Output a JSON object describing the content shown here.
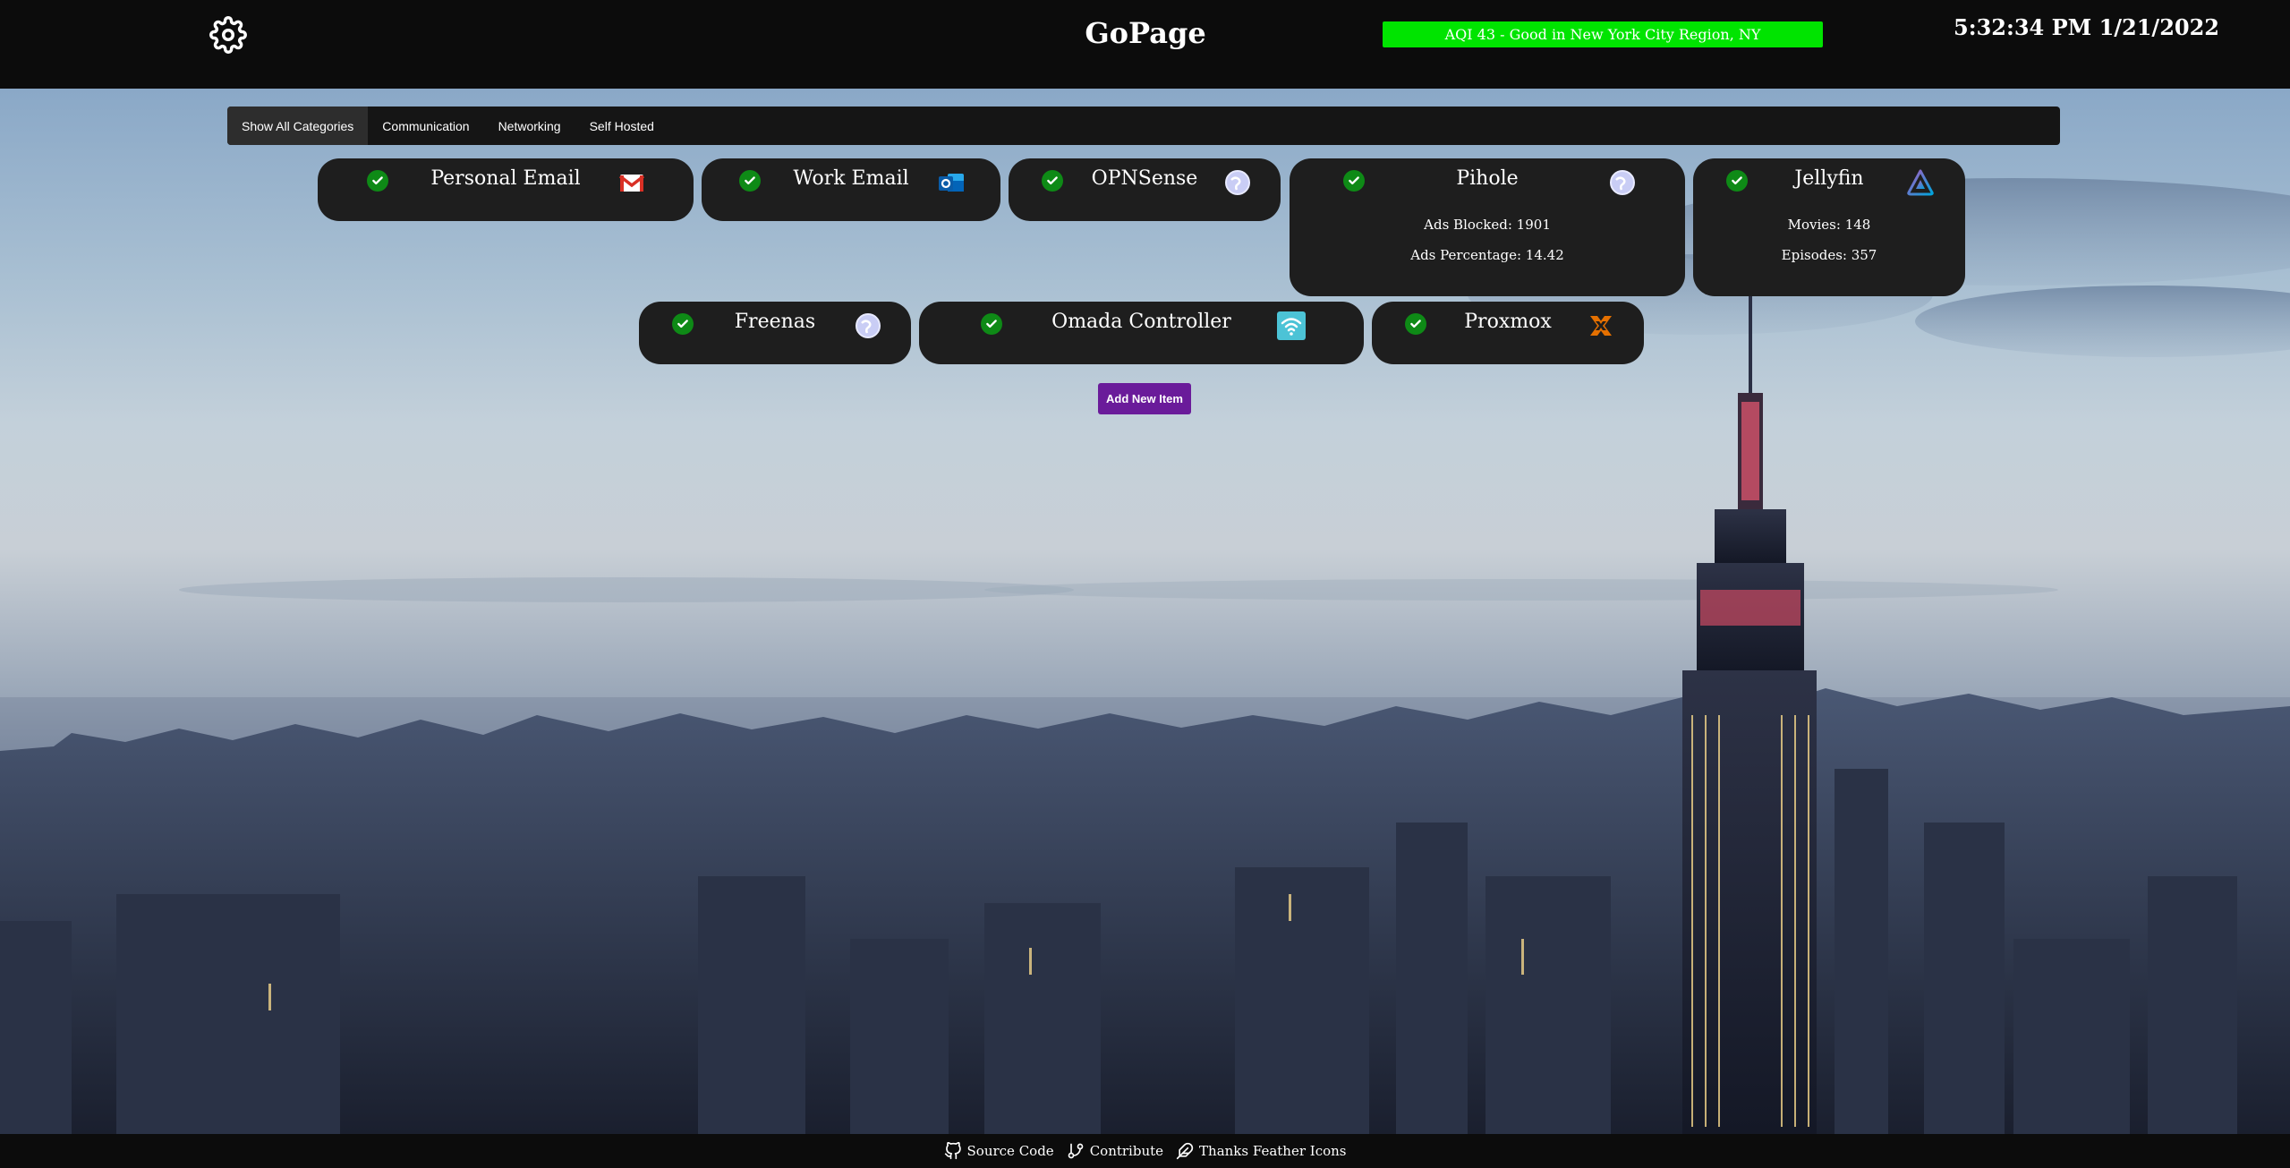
{
  "header": {
    "title": "GoPage",
    "aqi_text": "AQI 43 - Good in New York City Region, NY",
    "aqi_color": "#00e400",
    "clock": "5:32:34 PM 1/21/2022",
    "settings_icon": "gear-icon"
  },
  "tabs": [
    {
      "label": "Show All Categories",
      "active": true
    },
    {
      "label": "Communication"
    },
    {
      "label": "Networking"
    },
    {
      "label": "Self Hosted"
    }
  ],
  "cards": [
    {
      "title": "Personal Email",
      "icon": "gmail-icon",
      "status": "check-icon"
    },
    {
      "title": "Work Email",
      "icon": "outlook-icon",
      "status": "check-icon"
    },
    {
      "title": "OPNSense",
      "icon": "globe-icon",
      "status": "check-icon"
    },
    {
      "title": "Pihole",
      "icon": "globe-icon",
      "status": "check-icon",
      "stats": [
        "Ads Blocked: 1901",
        "Ads Percentage: 14.42"
      ]
    },
    {
      "title": "Jellyfin",
      "icon": "jellyfin-icon",
      "status": "check-icon",
      "stats": [
        "Movies: 148",
        "Episodes: 357"
      ]
    },
    {
      "title": "Freenas",
      "icon": "globe-icon",
      "status": "check-icon"
    },
    {
      "title": "Omada Controller",
      "icon": "wifi-icon",
      "status": "check-icon"
    },
    {
      "title": "Proxmox",
      "icon": "proxmox-icon",
      "status": "check-icon"
    }
  ],
  "add_button": "Add New Item",
  "footer": {
    "links": [
      {
        "label": "Source Code",
        "icon": "github-icon"
      },
      {
        "label": "Contribute",
        "icon": "git-branch-icon"
      },
      {
        "label": "Thanks Feather Icons",
        "icon": "feather-icon"
      }
    ]
  },
  "colors": {
    "accent_button": "#6a1b9a",
    "status_ok": "#0e8a16",
    "card_bg": "#1e1e1e"
  }
}
